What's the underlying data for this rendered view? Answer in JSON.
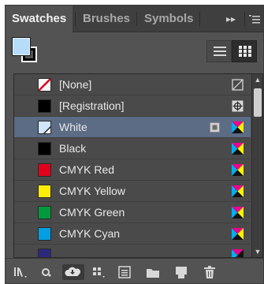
{
  "tabs": [
    {
      "label": "Swatches",
      "active": true
    },
    {
      "label": "Brushes",
      "active": false
    },
    {
      "label": "Symbols",
      "active": false
    }
  ],
  "tabbar_icons": {
    "collapse": "double-chevron-right-icon",
    "menu": "panel-menu-icon"
  },
  "fill_color": "#b6dcf7",
  "stroke_color": "#000000",
  "view_modes": [
    {
      "name": "list-view",
      "selected": false
    },
    {
      "name": "thumbnail-view",
      "selected": true
    }
  ],
  "swatches": [
    {
      "name": "[None]",
      "color": "none",
      "icon": "none-icon",
      "selected": false
    },
    {
      "name": "[Registration]",
      "color": "#000000",
      "icon": "registration-icon",
      "selected": false
    },
    {
      "name": "White",
      "color": "#ffffff",
      "icon": "process-cmyk-icon",
      "secondary_icon": "global-icon",
      "selected": true
    },
    {
      "name": "Black",
      "color": "#000000",
      "icon": "process-cmyk-icon",
      "selected": false
    },
    {
      "name": "CMYK Red",
      "color": "#e3001b",
      "icon": "process-cmyk-icon",
      "selected": false
    },
    {
      "name": "CMYK Yellow",
      "color": "#ffed00",
      "icon": "process-cmyk-icon",
      "selected": false
    },
    {
      "name": "CMYK Green",
      "color": "#009a3e",
      "icon": "process-cmyk-icon",
      "selected": false
    },
    {
      "name": "CMYK Cyan",
      "color": "#009fe3",
      "icon": "process-cmyk-icon",
      "selected": false
    },
    {
      "name": "",
      "color": "#2b2a7a",
      "icon": "process-cmyk-icon",
      "selected": false
    }
  ],
  "bottom_tools": [
    "swatch-libraries-icon",
    "eyedropper-add-icon",
    "cloud-library-icon",
    "show-swatch-kinds-icon",
    "swatch-options-icon",
    "new-color-group-icon",
    "new-swatch-icon",
    "delete-swatch-icon"
  ]
}
